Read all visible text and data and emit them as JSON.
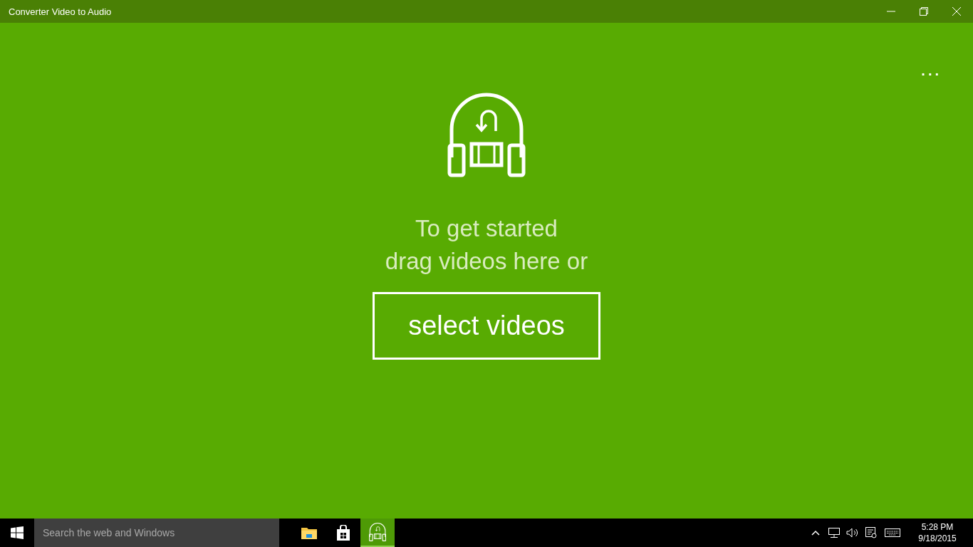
{
  "window": {
    "title": "Converter Video to Audio"
  },
  "main": {
    "more_label": "...",
    "heading_lines": [
      "To get started",
      "drag videos here or"
    ],
    "select_button": "select videos"
  },
  "taskbar": {
    "search": {
      "placeholder": "Search the web and Windows"
    },
    "apps": [
      {
        "kind": "explorer",
        "selected": false
      },
      {
        "kind": "store",
        "selected": false
      },
      {
        "kind": "converter",
        "selected": true
      }
    ],
    "time": "5:28 PM",
    "date": "9/18/2015"
  }
}
